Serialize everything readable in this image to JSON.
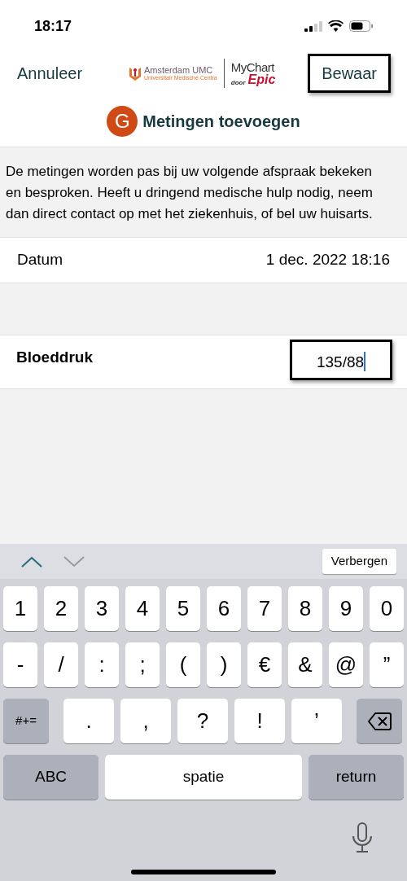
{
  "status_bar": {
    "time": "18:17"
  },
  "nav": {
    "cancel": "Annuleer",
    "save": {
      "label": "Bewaar",
      "highlighted": true
    },
    "logo": {
      "org": "Amsterdam UMC",
      "org_sub": "Universitair Medische Centra",
      "app": "MyChart",
      "by": "door",
      "vendor": "Epic"
    }
  },
  "title": {
    "avatar": "G",
    "text": "Metingen toevoegen"
  },
  "notice": "De metingen worden pas bij uw volgende afspraak bekeken en besproken. Heeft u dringend medische hulp nodig, neem dan direct contact op met het ziekenhuis, of bel uw huisarts.",
  "date_row": {
    "label": "Datum",
    "value": "1 dec. 2022 18:16"
  },
  "fields": [
    {
      "label": "Bloeddruk",
      "value": "135/88",
      "highlighted": true
    }
  ],
  "accessory": {
    "up_disabled": false,
    "down_disabled": true,
    "hide": "Verbergen"
  },
  "keyboard": {
    "number_row": [
      {
        "kind": "char",
        "label": "1"
      },
      {
        "kind": "char",
        "label": "2"
      },
      {
        "kind": "char",
        "label": "3"
      },
      {
        "kind": "char",
        "label": "4"
      },
      {
        "kind": "char",
        "label": "5"
      },
      {
        "kind": "char",
        "label": "6"
      },
      {
        "kind": "char",
        "label": "7"
      },
      {
        "kind": "char",
        "label": "8"
      },
      {
        "kind": "char",
        "label": "9"
      },
      {
        "kind": "char",
        "label": "0"
      }
    ],
    "symbol_row": [
      {
        "kind": "char",
        "label": "-"
      },
      {
        "kind": "char",
        "label": "/"
      },
      {
        "kind": "char",
        "label": ":"
      },
      {
        "kind": "char",
        "label": ";"
      },
      {
        "kind": "char",
        "label": "("
      },
      {
        "kind": "char",
        "label": ")"
      },
      {
        "kind": "char",
        "label": "€"
      },
      {
        "kind": "char",
        "label": "&"
      },
      {
        "kind": "char",
        "label": "@"
      },
      {
        "kind": "char",
        "label": "”"
      }
    ],
    "punctuation_row": [
      {
        "kind": "mode",
        "label": "#+="
      },
      {
        "kind": "wide",
        "label": "."
      },
      {
        "kind": "wide",
        "label": ","
      },
      {
        "kind": "wide",
        "label": "?"
      },
      {
        "kind": "wide",
        "label": "!"
      },
      {
        "kind": "wide",
        "label": "’"
      },
      {
        "kind": "delete"
      }
    ],
    "bottom_row": [
      {
        "kind": "function",
        "label": "ABC"
      },
      {
        "kind": "space",
        "label": "spatie"
      },
      {
        "kind": "function",
        "label": "return"
      }
    ]
  }
}
